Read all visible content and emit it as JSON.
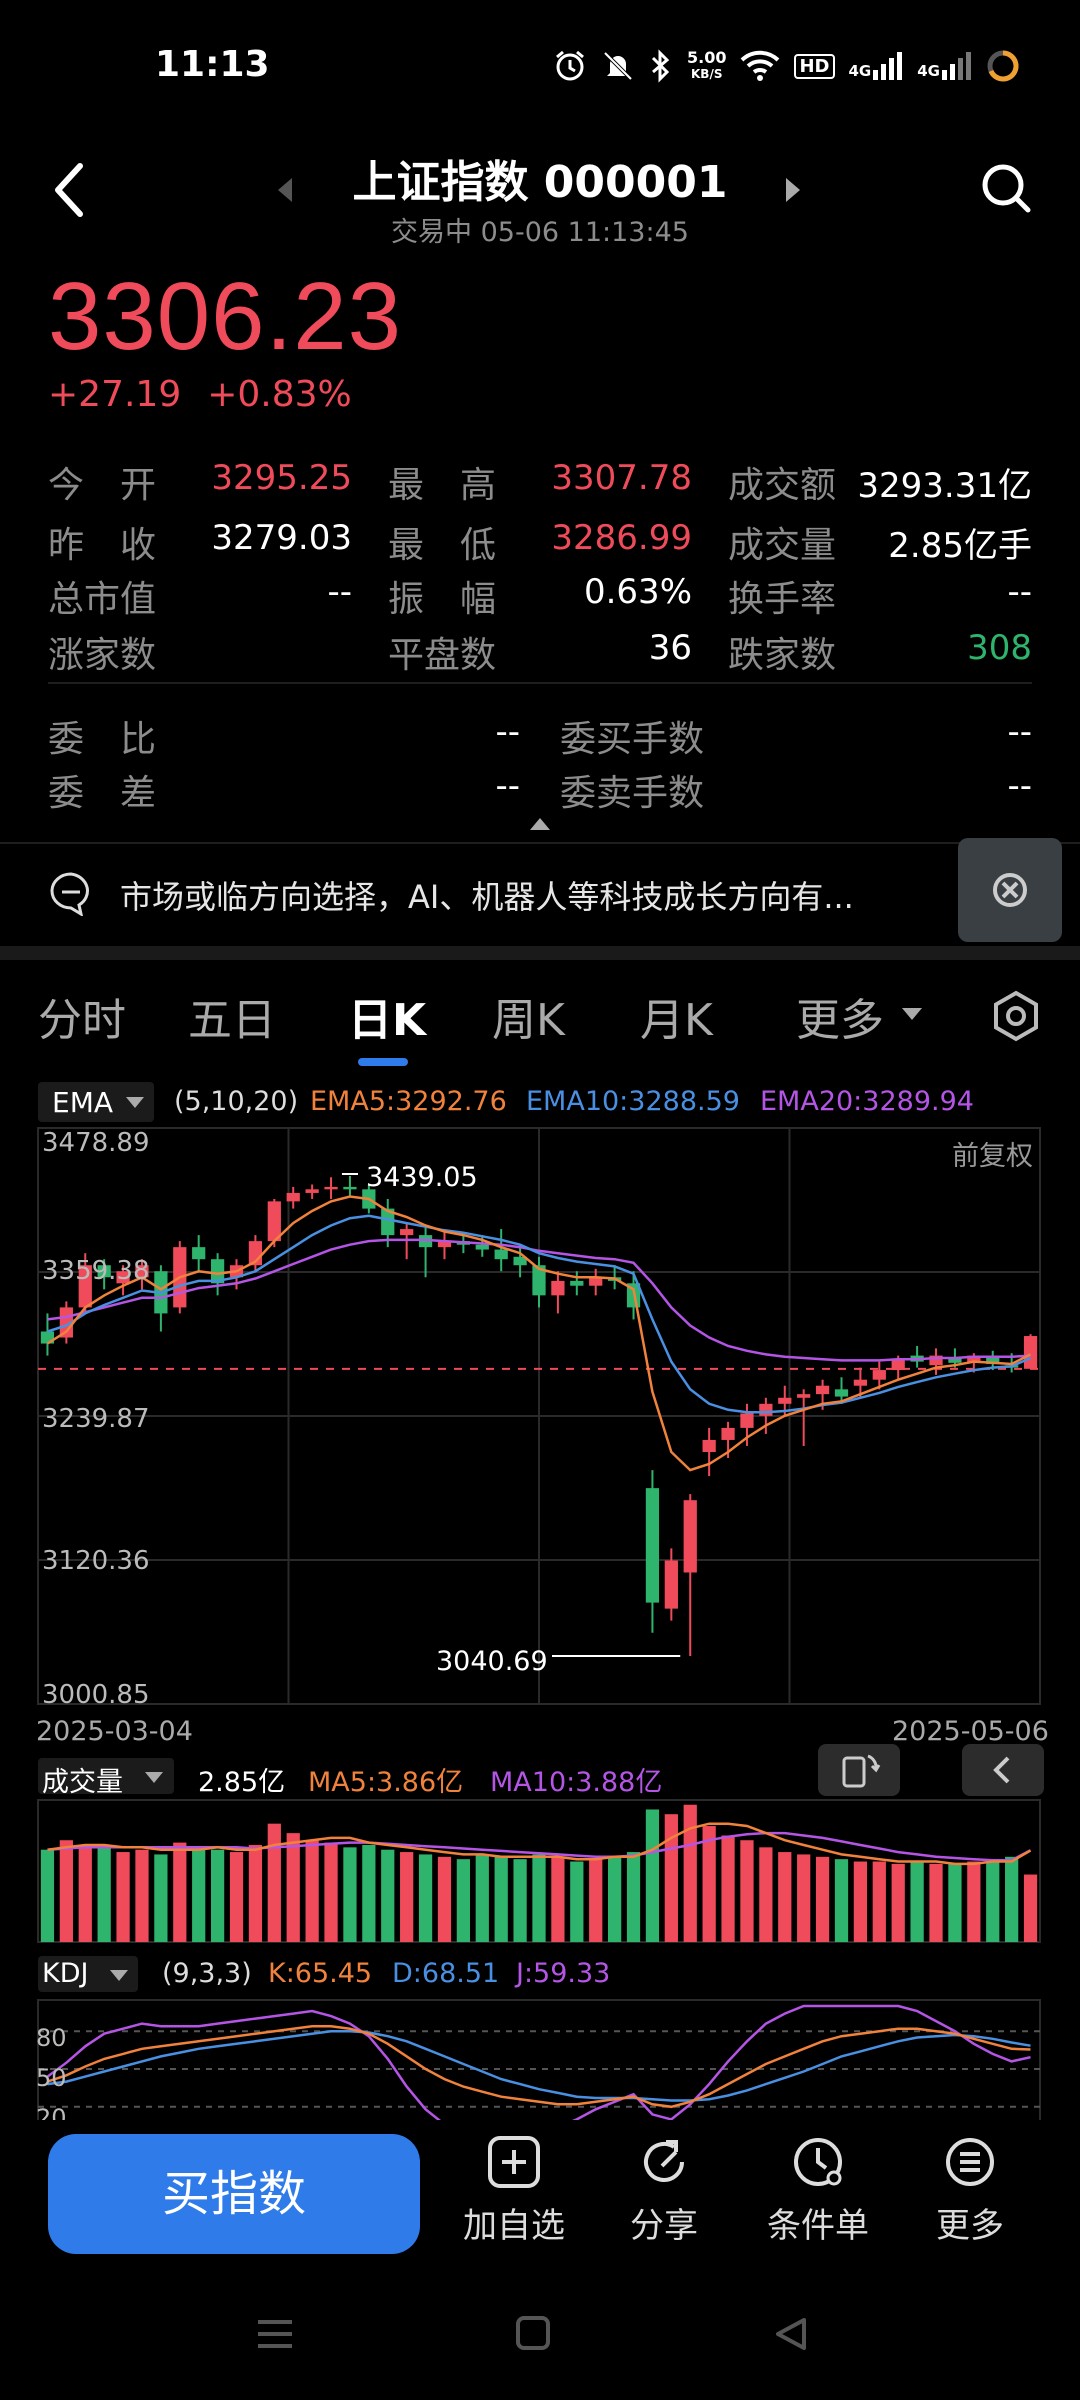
{
  "status": {
    "time": "11:13",
    "speed_value": "5.00",
    "speed_unit": "KB/S",
    "net1": "4G",
    "net2": "4G",
    "hd": "HD"
  },
  "header": {
    "title": "上证指数 000001",
    "subtitle": "交易中 05-06 11:13:45"
  },
  "quote": {
    "price": "3306.23",
    "change": "+27.19",
    "change_pct": "+0.83%"
  },
  "stats": [
    {
      "label": "今　开",
      "value": "3295.25",
      "color": "red"
    },
    {
      "label": "最　高",
      "value": "3307.78",
      "color": "red"
    },
    {
      "label": "成交额",
      "value": "3293.31亿",
      "color": "white"
    },
    {
      "label": "昨　收",
      "value": "3279.03",
      "color": "white"
    },
    {
      "label": "最　低",
      "value": "3286.99",
      "color": "red"
    },
    {
      "label": "成交量",
      "value": "2.85亿手",
      "color": "white"
    },
    {
      "label": "总市值",
      "value": "--",
      "color": "white"
    },
    {
      "label": "振　幅",
      "value": "0.63%",
      "color": "white"
    },
    {
      "label": "换手率",
      "value": "--",
      "color": "white"
    },
    {
      "label": "涨家数",
      "value": "",
      "color": "red"
    },
    {
      "label": "平盘数",
      "value": "36",
      "color": "white"
    },
    {
      "label": "跌家数",
      "value": "308",
      "color": "green"
    }
  ],
  "orders": [
    {
      "label": "委　比",
      "value": "--"
    },
    {
      "label": "委买手数",
      "value": "--"
    },
    {
      "label": "委　差",
      "value": "--"
    },
    {
      "label": "委卖手数",
      "value": "--"
    }
  ],
  "news": {
    "text": "市场或临方向选择，AI、机器人等科技成长方向有..."
  },
  "tabs": [
    "分时",
    "五日",
    "日K",
    "周K",
    "月K",
    "更多"
  ],
  "ema": {
    "select": "EMA",
    "params": "(5,10,20)",
    "ema5": "EMA5:3292.76",
    "ema10": "EMA10:3288.59",
    "ema20": "EMA20:3289.94"
  },
  "chart_labels": {
    "y_top": "3478.89",
    "y_2": "3359.38",
    "y_3": "3239.87",
    "y_4": "3120.36",
    "y_bottom": "3000.85",
    "fuquan": "前复权",
    "high_mark": "3439.05",
    "low_mark": "3040.69",
    "date_start": "2025-03-04",
    "date_end": "2025-05-06"
  },
  "volume": {
    "select": "成交量",
    "value": "2.85亿",
    "ma5": "MA5:3.86亿",
    "ma10": "MA10:3.88亿"
  },
  "kdj": {
    "select": "KDJ",
    "params": "(9,3,3)",
    "k": "K:65.45",
    "d": "D:68.51",
    "j": "J:59.33",
    "y80": "80",
    "y50": "50",
    "y20": "20"
  },
  "bottom_nav": {
    "buy": "买指数",
    "watch": "加自选",
    "share": "分享",
    "condition": "条件单",
    "more": "更多"
  },
  "colors": {
    "up": "#f04b5a",
    "down": "#2fb46e",
    "ema5": "#f0823c",
    "ema10": "#4a90e2",
    "ema20": "#b455e6",
    "accent": "#2f7bea"
  },
  "chart_data": {
    "type": "candlestick",
    "x_range": [
      "2025-03-04",
      "2025-05-06"
    ],
    "ylim": [
      3000.85,
      3478.89
    ],
    "ohlc": [
      [
        3310,
        3325,
        3290,
        3300
      ],
      [
        3305,
        3335,
        3300,
        3330
      ],
      [
        3330,
        3375,
        3325,
        3365
      ],
      [
        3365,
        3370,
        3345,
        3355
      ],
      [
        3350,
        3365,
        3340,
        3360
      ],
      [
        3355,
        3370,
        3345,
        3365
      ],
      [
        3360,
        3365,
        3310,
        3325
      ],
      [
        3330,
        3385,
        3325,
        3380
      ],
      [
        3380,
        3390,
        3360,
        3370
      ],
      [
        3370,
        3375,
        3340,
        3350
      ],
      [
        3355,
        3370,
        3345,
        3365
      ],
      [
        3365,
        3390,
        3360,
        3385
      ],
      [
        3385,
        3420,
        3380,
        3418
      ],
      [
        3418,
        3430,
        3412,
        3425
      ],
      [
        3425,
        3432,
        3420,
        3428
      ],
      [
        3428,
        3438,
        3420,
        3430
      ],
      [
        3430,
        3439.05,
        3422,
        3428
      ],
      [
        3428,
        3432,
        3408,
        3412
      ],
      [
        3412,
        3420,
        3380,
        3390
      ],
      [
        3390,
        3400,
        3370,
        3395
      ],
      [
        3390,
        3398,
        3355,
        3380
      ],
      [
        3380,
        3395,
        3370,
        3385
      ],
      [
        3385,
        3392,
        3375,
        3382
      ],
      [
        3382,
        3390,
        3372,
        3378
      ],
      [
        3378,
        3395,
        3360,
        3370
      ],
      [
        3372,
        3382,
        3355,
        3365
      ],
      [
        3365,
        3372,
        3330,
        3340
      ],
      [
        3340,
        3360,
        3325,
        3352
      ],
      [
        3352,
        3360,
        3340,
        3348
      ],
      [
        3348,
        3362,
        3340,
        3355
      ],
      [
        3355,
        3365,
        3345,
        3352
      ],
      [
        3350,
        3360,
        3320,
        3330
      ],
      [
        3180,
        3195,
        3060,
        3085
      ],
      [
        3080,
        3130,
        3070,
        3120
      ],
      [
        3110,
        3175,
        3040.69,
        3170
      ],
      [
        3210,
        3230,
        3190,
        3220
      ],
      [
        3220,
        3235,
        3205,
        3230
      ],
      [
        3230,
        3250,
        3215,
        3242
      ],
      [
        3240,
        3255,
        3225,
        3250
      ],
      [
        3250,
        3265,
        3240,
        3255
      ],
      [
        3255,
        3262,
        3215,
        3258
      ],
      [
        3258,
        3270,
        3245,
        3265
      ],
      [
        3262,
        3272,
        3250,
        3256
      ],
      [
        3265,
        3280,
        3255,
        3270
      ],
      [
        3270,
        3285,
        3262,
        3278
      ],
      [
        3278,
        3290,
        3270,
        3286
      ],
      [
        3290,
        3298,
        3280,
        3285
      ],
      [
        3282,
        3296,
        3274,
        3290
      ],
      [
        3288,
        3296,
        3280,
        3284
      ],
      [
        3284,
        3292,
        3276,
        3290
      ],
      [
        3290,
        3294,
        3278,
        3283
      ],
      [
        3282,
        3292,
        3276,
        3280
      ],
      [
        3279.03,
        3307.78,
        3286.99,
        3306.23
      ]
    ],
    "ema5": [
      3300,
      3310,
      3330,
      3340,
      3348,
      3355,
      3345,
      3355,
      3360,
      3358,
      3360,
      3368,
      3385,
      3400,
      3410,
      3418,
      3422,
      3420,
      3410,
      3405,
      3398,
      3393,
      3390,
      3386,
      3380,
      3375,
      3362,
      3358,
      3355,
      3355,
      3354,
      3345,
      3260,
      3210,
      3195,
      3200,
      3210,
      3222,
      3232,
      3240,
      3245,
      3250,
      3252,
      3258,
      3264,
      3270,
      3275,
      3280,
      3282,
      3285,
      3284,
      3283,
      3291
    ],
    "ema10": [
      3310,
      3315,
      3325,
      3332,
      3338,
      3344,
      3342,
      3348,
      3352,
      3352,
      3355,
      3360,
      3370,
      3380,
      3390,
      3398,
      3404,
      3406,
      3403,
      3400,
      3397,
      3394,
      3392,
      3389,
      3386,
      3382,
      3375,
      3371,
      3368,
      3366,
      3364,
      3358,
      3320,
      3285,
      3262,
      3250,
      3245,
      3243,
      3243,
      3244,
      3246,
      3249,
      3251,
      3255,
      3259,
      3264,
      3268,
      3272,
      3275,
      3278,
      3280,
      3281,
      3288
    ],
    "ema20": [
      3320,
      3322,
      3326,
      3330,
      3334,
      3338,
      3338,
      3342,
      3346,
      3348,
      3350,
      3354,
      3360,
      3366,
      3372,
      3378,
      3382,
      3385,
      3386,
      3386,
      3386,
      3385,
      3384,
      3383,
      3382,
      3380,
      3377,
      3375,
      3373,
      3371,
      3370,
      3367,
      3350,
      3330,
      3315,
      3305,
      3298,
      3294,
      3291,
      3289,
      3288,
      3287,
      3286,
      3286,
      3286,
      3287,
      3287,
      3288,
      3288,
      3289,
      3289,
      3289,
      3290
    ],
    "volume": [
      3.9,
      4.3,
      4.1,
      4.0,
      3.8,
      3.9,
      3.7,
      4.2,
      4.0,
      3.9,
      3.8,
      4.1,
      5.0,
      4.6,
      4.3,
      4.2,
      4.0,
      4.1,
      3.9,
      3.8,
      3.7,
      3.6,
      3.5,
      3.7,
      3.6,
      3.5,
      3.7,
      3.6,
      3.4,
      3.5,
      3.6,
      3.8,
      5.6,
      5.4,
      5.8,
      4.9,
      4.5,
      4.3,
      4.0,
      3.8,
      3.7,
      3.6,
      3.5,
      3.4,
      3.4,
      3.3,
      3.4,
      3.3,
      3.3,
      3.4,
      3.5,
      3.6,
      2.85
    ],
    "vol_ma5": [
      3.9,
      4.0,
      4.1,
      4.1,
      4.0,
      4.0,
      3.9,
      3.9,
      3.9,
      4.0,
      3.9,
      3.9,
      4.1,
      4.2,
      4.3,
      4.4,
      4.4,
      4.2,
      4.1,
      4.0,
      3.9,
      3.8,
      3.7,
      3.7,
      3.6,
      3.6,
      3.6,
      3.6,
      3.5,
      3.5,
      3.6,
      3.6,
      3.9,
      4.4,
      4.8,
      5.0,
      5.0,
      4.9,
      4.6,
      4.3,
      4.1,
      3.9,
      3.7,
      3.6,
      3.5,
      3.4,
      3.4,
      3.4,
      3.3,
      3.3,
      3.4,
      3.4,
      3.86
    ],
    "vol_ma10": [
      3.9,
      3.95,
      4.0,
      4.0,
      4.0,
      4.0,
      4.0,
      4.0,
      4.0,
      4.0,
      4.0,
      3.95,
      4.0,
      4.05,
      4.1,
      4.15,
      4.2,
      4.2,
      4.15,
      4.1,
      4.05,
      4.0,
      3.95,
      3.9,
      3.85,
      3.8,
      3.75,
      3.7,
      3.65,
      3.6,
      3.6,
      3.65,
      3.8,
      3.95,
      4.1,
      4.3,
      4.45,
      4.55,
      4.6,
      4.6,
      4.5,
      4.4,
      4.25,
      4.1,
      3.95,
      3.8,
      3.7,
      3.6,
      3.55,
      3.5,
      3.45,
      3.45,
      3.88
    ],
    "kdj_k": [
      40,
      45,
      52,
      58,
      62,
      66,
      68,
      70,
      72,
      74,
      76,
      78,
      80,
      82,
      84,
      84,
      82,
      78,
      70,
      60,
      50,
      42,
      36,
      32,
      28,
      26,
      24,
      22,
      22,
      24,
      26,
      28,
      22,
      20,
      24,
      30,
      38,
      46,
      54,
      60,
      66,
      72,
      76,
      78,
      80,
      82,
      82,
      80,
      78,
      74,
      70,
      66,
      65.45
    ],
    "kdj_d": [
      38,
      40,
      44,
      48,
      52,
      56,
      60,
      63,
      66,
      68,
      70,
      72,
      74,
      76,
      78,
      80,
      80,
      79,
      76,
      72,
      66,
      60,
      54,
      48,
      42,
      38,
      34,
      31,
      28,
      27,
      27,
      27,
      26,
      25,
      25,
      26,
      29,
      33,
      38,
      43,
      48,
      54,
      60,
      64,
      68,
      72,
      75,
      76,
      77,
      76,
      74,
      71,
      68.51
    ],
    "kdj_j": [
      44,
      55,
      68,
      78,
      82,
      86,
      84,
      84,
      84,
      86,
      88,
      90,
      92,
      94,
      96,
      92,
      86,
      76,
      58,
      36,
      18,
      6,
      2,
      0,
      0,
      2,
      4,
      4,
      10,
      18,
      24,
      30,
      14,
      10,
      22,
      38,
      56,
      72,
      86,
      94,
      100,
      100,
      100,
      100,
      100,
      100,
      96,
      88,
      80,
      70,
      62,
      56,
      59.33
    ]
  }
}
